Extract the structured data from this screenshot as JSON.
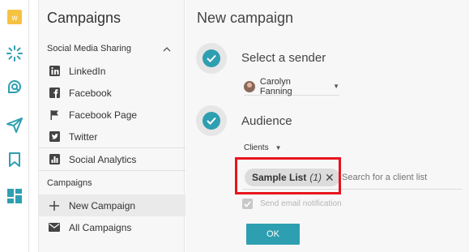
{
  "rail": {
    "icons": [
      "logo-icon",
      "hub-icon",
      "search-chat-icon",
      "send-icon",
      "bookmark-icon",
      "dashboard-icon"
    ]
  },
  "sidebar": {
    "title": "Campaigns",
    "section1": "Social Media Sharing",
    "items": [
      {
        "label": "LinkedIn",
        "icon": "linkedin-icon"
      },
      {
        "label": "Facebook",
        "icon": "facebook-icon"
      },
      {
        "label": "Facebook Page",
        "icon": "flag-icon"
      },
      {
        "label": "Twitter",
        "icon": "twitter-icon"
      },
      {
        "label": "Social Analytics",
        "icon": "analytics-icon"
      }
    ],
    "section2": "Campaigns",
    "campaign_items": [
      {
        "label": "New Campaign",
        "icon": "plus-icon"
      },
      {
        "label": "All Campaigns",
        "icon": "mail-icon"
      }
    ]
  },
  "main": {
    "title": "New campaign",
    "step1_title": "Select a sender",
    "sender_name": "Carolyn Fanning",
    "step2_title": "Audience",
    "audience_type": "Clients",
    "chip_name": "Sample List",
    "chip_count": "(1)",
    "search_placeholder": "Search for a client list",
    "notify_label": "Send email notification",
    "ok_label": "OK"
  },
  "colors": {
    "accent": "#2e9fb0",
    "highlight": "#e8141c",
    "logo": "#f5c242"
  }
}
